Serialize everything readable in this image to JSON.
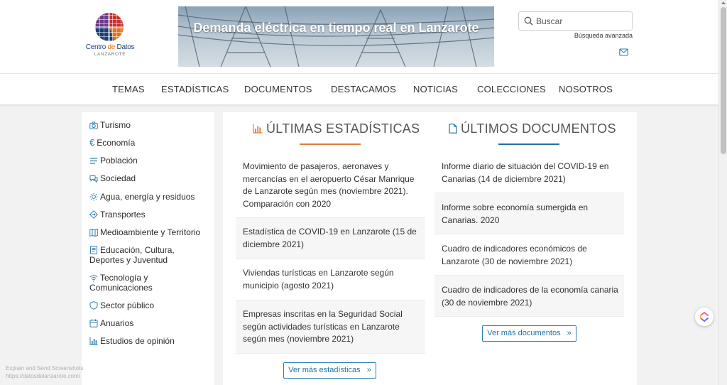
{
  "header": {
    "logo": {
      "name_part1": "Centro ",
      "name_part2": "de",
      "name_part3": " Datos",
      "sublabel": "LANZAROTE"
    },
    "banner_title": "Demanda eléctrica en tiempo real en Lanzarote",
    "search": {
      "placeholder": "Buscar",
      "icon": "search-icon"
    },
    "advanced_search": "Búsqueda avanzada",
    "mail_icon": "mail-icon"
  },
  "nav": {
    "items": [
      {
        "label": "TEMAS"
      },
      {
        "label": "ESTADÍSTICAS"
      },
      {
        "label": "DOCUMENTOS"
      },
      {
        "label": "DESTACAMOS"
      },
      {
        "label": "NOTICIAS"
      },
      {
        "label": "COLECCIONES"
      },
      {
        "label": "NOSOTROS"
      }
    ]
  },
  "sidebar": {
    "items": [
      {
        "label": "Turismo",
        "icon": "camera-icon"
      },
      {
        "label": "Economía",
        "icon": "euro-icon"
      },
      {
        "label": "Población",
        "icon": "list-icon"
      },
      {
        "label": "Sociedad",
        "icon": "chat-icon"
      },
      {
        "label": "Agua, energía y residuos",
        "icon": "sun-icon"
      },
      {
        "label": "Transportes",
        "icon": "diamond-icon"
      },
      {
        "label": "Medioambiente y Territorio",
        "icon": "map-icon"
      },
      {
        "label": "Educación, Cultura, Deportes y Juventud",
        "icon": "book-icon"
      },
      {
        "label": "Tecnología y Comunicaciones",
        "icon": "wifi-icon"
      },
      {
        "label": "Sector público",
        "icon": "shield-icon"
      },
      {
        "label": "Anuarios",
        "icon": "calendar-icon"
      },
      {
        "label": "Estudios de opinión",
        "icon": "bar-chart-icon"
      }
    ]
  },
  "main": {
    "statistics": {
      "title": "ÚLTIMAS ESTADÍSTICAS",
      "icon": "bar-chart-icon",
      "accent": "#e07b39",
      "items": [
        {
          "text": "Movimiento de pasajeros, aeronaves y mercancías en el aeropuerto César Manrique de Lanzarote según mes (noviembre 2021). Comparación con 2020"
        },
        {
          "text": "Estadística de COVID-19 en Lanzarote (15 de diciembre 2021)"
        },
        {
          "text": "Viviendas turísticas en Lanzarote según municipio (agosto 2021)"
        },
        {
          "text": "Empresas inscritas en la Seguridad Social según actividades turísticas en Lanzarote según mes (noviembre 2021)"
        }
      ],
      "more_label": "Ver más estadísticas"
    },
    "documents": {
      "title": "ÚLTIMOS DOCUMENTOS",
      "icon": "document-icon",
      "accent": "#1e73a8",
      "items": [
        {
          "text": "Informe diario de situación del COVID-19 en Canarias (14 de diciembre 2021)"
        },
        {
          "text": "Informe sobre economía sumergida en Canarias. 2020"
        },
        {
          "text": "Cuadro de indicadores económicos de Lanzarote (30 de noviembre 2021)"
        },
        {
          "text": "Cuadro de indicadores de la economía canaria (30 de noviembre 2021)"
        }
      ],
      "more_label": "Ver más documentos"
    }
  },
  "watermark": {
    "line1": "Explain and Send Screenshots",
    "line2": "https://datosdelanzarote.com/"
  }
}
